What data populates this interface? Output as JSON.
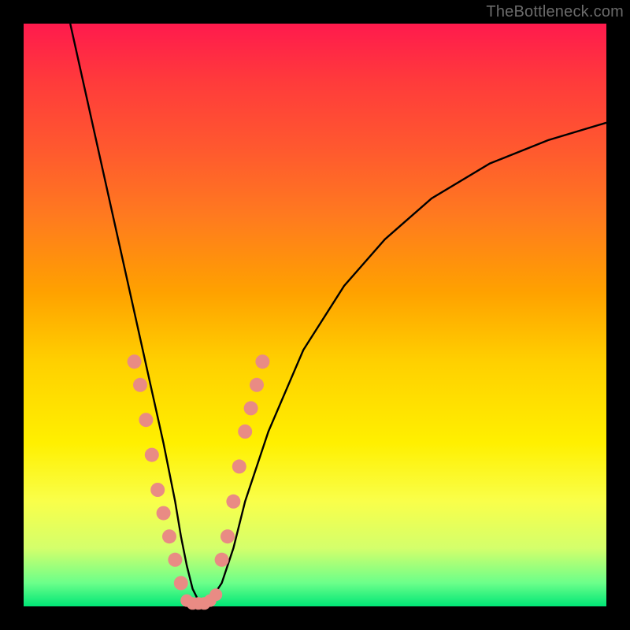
{
  "watermark": "TheBottleneck.com",
  "chart_data": {
    "type": "line",
    "title": "",
    "xlabel": "",
    "ylabel": "",
    "xlim": [
      0,
      100
    ],
    "ylim": [
      0,
      100
    ],
    "series": [
      {
        "name": "curve",
        "x": [
          8,
          10,
          12,
          14,
          16,
          18,
          20,
          22,
          24,
          26,
          27,
          28,
          29,
          30,
          32,
          34,
          36,
          38,
          42,
          48,
          55,
          62,
          70,
          80,
          90,
          100
        ],
        "y": [
          100,
          91,
          82,
          73,
          64,
          55,
          46,
          37,
          28,
          18,
          12,
          7,
          3,
          1,
          1,
          4,
          10,
          18,
          30,
          44,
          55,
          63,
          70,
          76,
          80,
          83
        ]
      }
    ],
    "markers": {
      "name": "highlight-points",
      "color": "#e98b84",
      "left_cluster_x": [
        19,
        20,
        21,
        22,
        23,
        24,
        25,
        26,
        27
      ],
      "left_cluster_y": [
        42,
        38,
        32,
        26,
        20,
        16,
        12,
        8,
        4
      ],
      "bottom_cluster_x": [
        28,
        29,
        30,
        31,
        32,
        33
      ],
      "bottom_cluster_y": [
        1,
        0.5,
        0.5,
        0.5,
        1,
        2
      ],
      "right_cluster_x": [
        34,
        35,
        36,
        37,
        38,
        39,
        40,
        41
      ],
      "right_cluster_y": [
        8,
        12,
        18,
        24,
        30,
        34,
        38,
        42
      ]
    },
    "gradient_stops": [
      {
        "pos": 0.0,
        "color": "#ff1a4d"
      },
      {
        "pos": 0.22,
        "color": "#ff5a2e"
      },
      {
        "pos": 0.46,
        "color": "#ffa100"
      },
      {
        "pos": 0.72,
        "color": "#fff000"
      },
      {
        "pos": 0.9,
        "color": "#d4ff6b"
      },
      {
        "pos": 1.0,
        "color": "#00e676"
      }
    ]
  }
}
